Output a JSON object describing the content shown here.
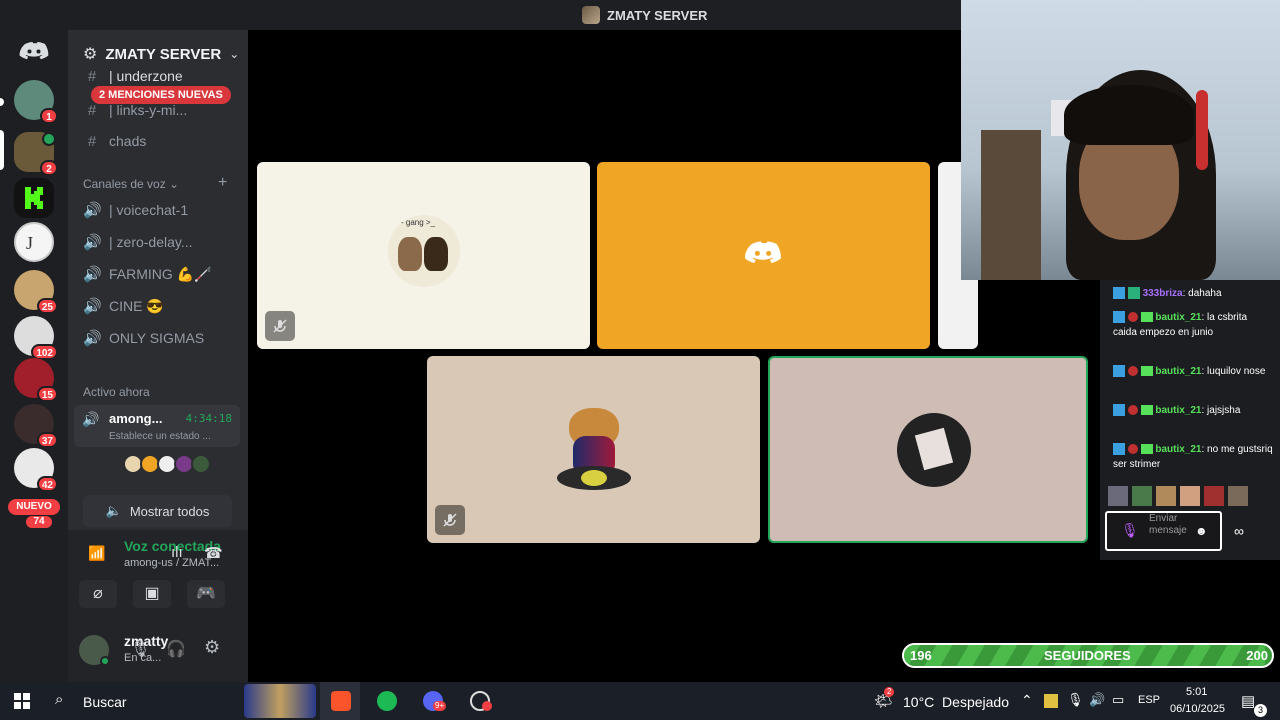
{
  "title_bar": {
    "server_name": "ZMATY SERVER"
  },
  "rail": {
    "badges": [
      "1",
      "2",
      "25",
      "102",
      "15",
      "37",
      "42",
      "74"
    ],
    "new_label": "NUEVO"
  },
  "sidebar": {
    "server_name": "ZMATY SERVER",
    "mentions_pill": "2 MENCIONES NUEVAS",
    "text_channels": [
      "| underzone",
      "| links-y-mi...",
      "chads"
    ],
    "voice_category": "Canales de voz",
    "voice_channels": [
      "| voicechat-1",
      "| zero-delay...",
      "FARMING 💪🦯",
      "CINE 😎",
      "ONLY SIGMAS"
    ],
    "active_now_label": "Activo ahora",
    "active": {
      "name": "among...",
      "timer": "4:34:18",
      "status": "Establece un estado ..."
    },
    "show_all": "Mostrar todos",
    "voice_connected": {
      "title": "Voz conectada",
      "subtitle": "among-us / ZMAT..."
    },
    "user": {
      "name": "zmatty",
      "status": "En ca..."
    }
  },
  "stage": {
    "tile1_caption": "- gang >_"
  },
  "chat": {
    "messages": [
      {
        "user": "333briza",
        "text": ": dahaha",
        "color": "#a970ff"
      },
      {
        "user": "bautix_21",
        "text": ": la csbrita caida empezo en junio",
        "color": "#57e05a"
      },
      {
        "user": "bautix_21",
        "text": ": luquilov nose",
        "color": "#57e05a"
      },
      {
        "user": "bautix_21",
        "text": ": jajsjsha",
        "color": "#57e05a"
      },
      {
        "user": "bautix_21",
        "text": ": no me gustsriq ser strimer",
        "color": "#57e05a"
      }
    ],
    "input_placeholder": "Enviar mensaje"
  },
  "followers": {
    "current": "196",
    "label": "SEGUIDORES",
    "goal": "200",
    "progress": 0.98
  },
  "taskbar": {
    "search": "Buscar",
    "weather": "10°C  Despejado",
    "lang": "ESP",
    "time": "5:01",
    "date": "06/10/2025",
    "notif_count": "3",
    "discord_badge": "9+",
    "weather_badge": "2"
  },
  "colors": {
    "accent": "#5865f2",
    "green": "#23a55a",
    "red": "#f23f43",
    "tile_orange": "#f0a524"
  }
}
